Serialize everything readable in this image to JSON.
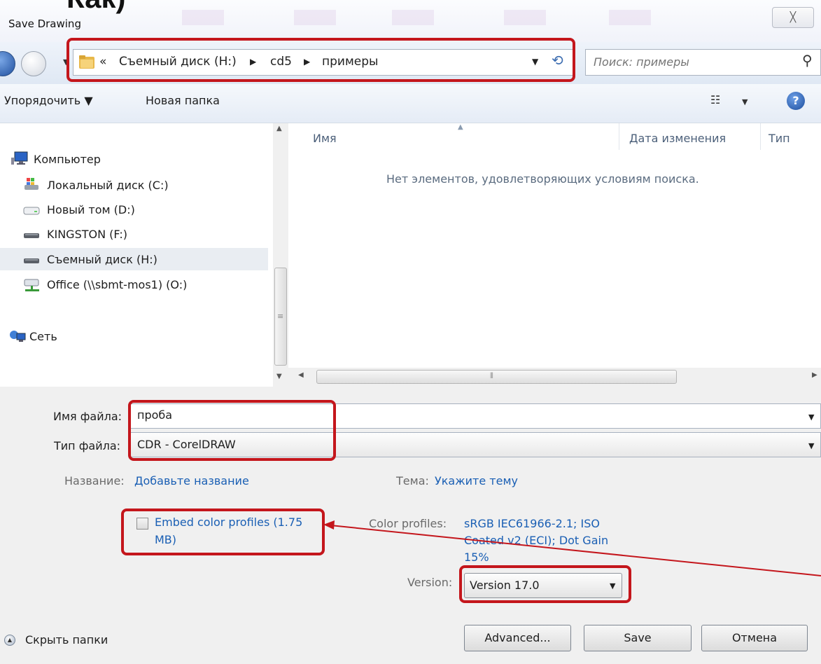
{
  "slide_heading": "Как)",
  "window": {
    "title": "Save Drawing",
    "close_label": "╳"
  },
  "address": {
    "chevron": "«",
    "crumbs": [
      "Съемный диск (H:)",
      "cd5",
      "примеры"
    ],
    "separator": "▶"
  },
  "search": {
    "placeholder": "Поиск: примеры",
    "icon": "magnifier-icon"
  },
  "toolbar": {
    "organize": "Упорядочить ▼",
    "new_folder": "Новая папка",
    "view_icon": "☷",
    "help": "?"
  },
  "nav": {
    "items": [
      {
        "label": "Компьютер",
        "icon": "computer-icon"
      },
      {
        "label": "Локальный диск (C:)",
        "icon": "windows-drive-icon"
      },
      {
        "label": "Новый том (D:)",
        "icon": "drive-icon"
      },
      {
        "label": "KINGSTON (F:)",
        "icon": "usb-drive-icon"
      },
      {
        "label": "Съемный диск (H:)",
        "icon": "usb-drive-icon",
        "selected": true
      },
      {
        "label": "Office (\\\\sbmt-mos1) (O:)",
        "icon": "network-drive-icon"
      },
      {
        "label": "Сеть",
        "icon": "network-icon"
      }
    ]
  },
  "file_list": {
    "columns": [
      "Имя",
      "Дата изменения",
      "Тип"
    ],
    "empty_message": "Нет элементов, удовлетворяющих условиям поиска."
  },
  "form": {
    "filename_label": "Имя файла:",
    "filename_value": "проба",
    "filetype_label": "Тип файла:",
    "filetype_value": "CDR - CorelDRAW",
    "title_label": "Название:",
    "title_value": "Добавьте название",
    "subject_label": "Тема:",
    "subject_value": "Укажите тему",
    "embed_line1": "Embed color profiles (1.75",
    "embed_line2": "MB)",
    "embed_checked": false,
    "profiles_label": "Color profiles:",
    "profiles_line1": "sRGB IEC61966-2.1; ISO",
    "profiles_line2": "Coated v2 (ECI); Dot Gain",
    "profiles_line3": "15%",
    "version_label": "Version:",
    "version_value": "Version 17.0"
  },
  "buttons": {
    "advanced": "Advanced...",
    "save": "Save",
    "cancel": "Отмена"
  },
  "footer": {
    "hide_folders": "Скрыть папки"
  },
  "colors": {
    "highlight": "#c4161c",
    "link": "#1a5fb4",
    "panel": "#f0f0f0"
  }
}
